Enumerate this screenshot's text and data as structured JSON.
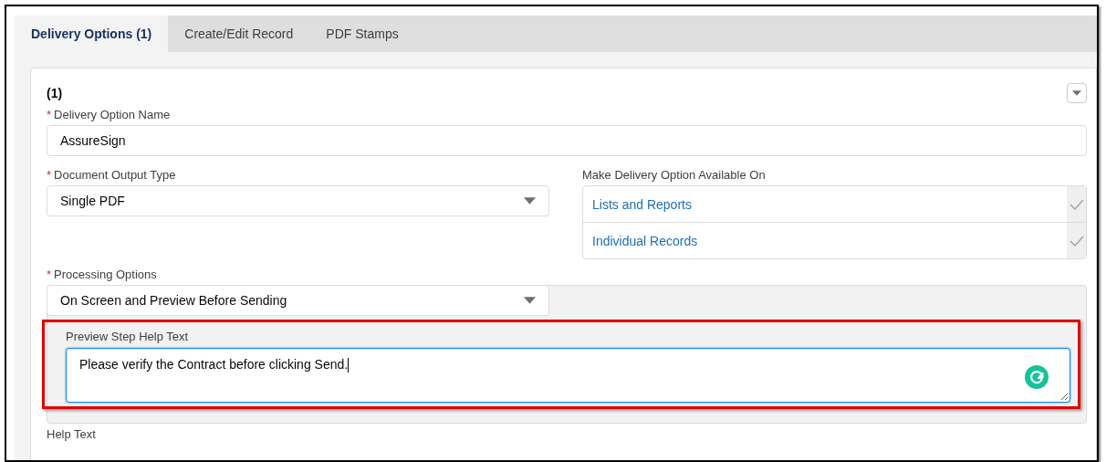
{
  "tabs": [
    {
      "label": "Delivery Options (1)",
      "selected": true
    },
    {
      "label": "Create/Edit Record",
      "selected": false
    },
    {
      "label": "PDF Stamps",
      "selected": false
    }
  ],
  "section": {
    "title": "(1)"
  },
  "fields": {
    "delivery_option_name": {
      "label": "Delivery Option Name",
      "required_mark": "*",
      "value": "AssureSign"
    },
    "document_output_type": {
      "label": "Document Output Type",
      "required_mark": "*",
      "value": "Single PDF"
    },
    "available_on": {
      "label": "Make Delivery Option Available On",
      "items": [
        {
          "label": "Lists and Reports",
          "checked": true
        },
        {
          "label": "Individual Records",
          "checked": true
        }
      ]
    },
    "processing_options": {
      "label": "Processing Options",
      "required_mark": "*",
      "value": "On Screen and Preview Before Sending"
    },
    "preview_step_help_text": {
      "label": "Preview Step Help Text",
      "value": "Please verify the Contract before clicking Send.",
      "highlighted": true
    },
    "help_text": {
      "label": "Help Text"
    }
  }
}
